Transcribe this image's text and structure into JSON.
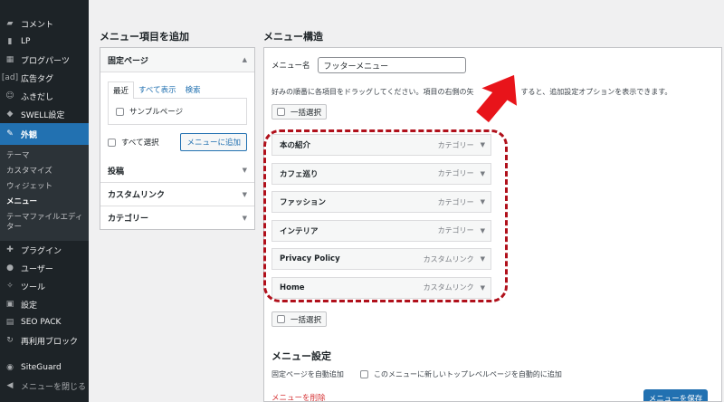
{
  "sidebar": {
    "items": [
      {
        "icon": "comment-icon",
        "glyph": "▰",
        "label": "コメント"
      },
      {
        "icon": "page-icon",
        "glyph": "▮",
        "label": "LP"
      },
      {
        "icon": "blocks-icon",
        "glyph": "▦",
        "label": "ブログパーツ"
      },
      {
        "icon": "ad-icon",
        "glyph": "[ad]",
        "label": "広告タグ"
      },
      {
        "icon": "balloon-icon",
        "glyph": "☺",
        "label": "ふきだし"
      },
      {
        "icon": "swell-icon",
        "glyph": "◆",
        "label": "SWELL設定"
      }
    ],
    "active": {
      "icon": "appearance-icon",
      "glyph": "✎",
      "label": "外観"
    },
    "submenu": [
      "テーマ",
      "カスタマイズ",
      "ウィジェット",
      "メニュー",
      "テーマファイルエディター"
    ],
    "items_after": [
      {
        "icon": "plugin-icon",
        "glyph": "✚",
        "label": "プラグイン"
      },
      {
        "icon": "users-icon",
        "glyph": "●",
        "label": "ユーザー"
      },
      {
        "icon": "tools-icon",
        "glyph": "✧",
        "label": "ツール"
      },
      {
        "icon": "settings-icon",
        "glyph": "▣",
        "label": "設定"
      },
      {
        "icon": "seo-icon",
        "glyph": "▤",
        "label": "SEO PACK"
      },
      {
        "icon": "reusable-icon",
        "glyph": "↻",
        "label": "再利用ブロック"
      }
    ],
    "siteguard": {
      "icon": "siteguard-icon",
      "glyph": "◉",
      "label": "SiteGuard"
    },
    "collapse": {
      "icon": "collapse-icon",
      "glyph": "◀",
      "label": "メニューを閉じる"
    }
  },
  "left": {
    "title": "メニュー項目を追加",
    "fixed_page": {
      "label": "固定ページ",
      "tabs": [
        "最近",
        "すべて表示",
        "検索"
      ],
      "page_option": "サンプルページ",
      "select_all": "すべて選択",
      "add_button": "メニューに追加"
    },
    "sections": [
      "投稿",
      "カスタムリンク",
      "カテゴリー"
    ]
  },
  "right": {
    "title": "メニュー構造",
    "menu_name_label": "メニュー名",
    "menu_name_value": "フッターメニュー",
    "instructions": "好みの順番に各項目をドラッグしてください。項目の右側の矢",
    "instructions_tail": "すると、追加設定オプションを表示できます。",
    "bulk_select": "一括選択",
    "items": [
      {
        "title": "本の紹介",
        "type": "カテゴリー"
      },
      {
        "title": "カフェ巡り",
        "type": "カテゴリー"
      },
      {
        "title": "ファッション",
        "type": "カテゴリー"
      },
      {
        "title": "インテリア",
        "type": "カテゴリー"
      },
      {
        "title": "Privacy Policy",
        "type": "カスタムリンク"
      },
      {
        "title": "Home",
        "type": "カスタムリンク"
      }
    ],
    "settings_title": "メニュー設定",
    "auto_add_label": "固定ページを自動追加",
    "auto_add_option": "このメニューに新しいトップレベルページを自動的に追加",
    "delete_link": "メニューを削除",
    "save_button": "メニューを保存"
  },
  "colors": {
    "annotation": "#b0101b",
    "arrow": "#e8141a",
    "accent": "#2271b1",
    "sidebar": "#1d2327"
  }
}
